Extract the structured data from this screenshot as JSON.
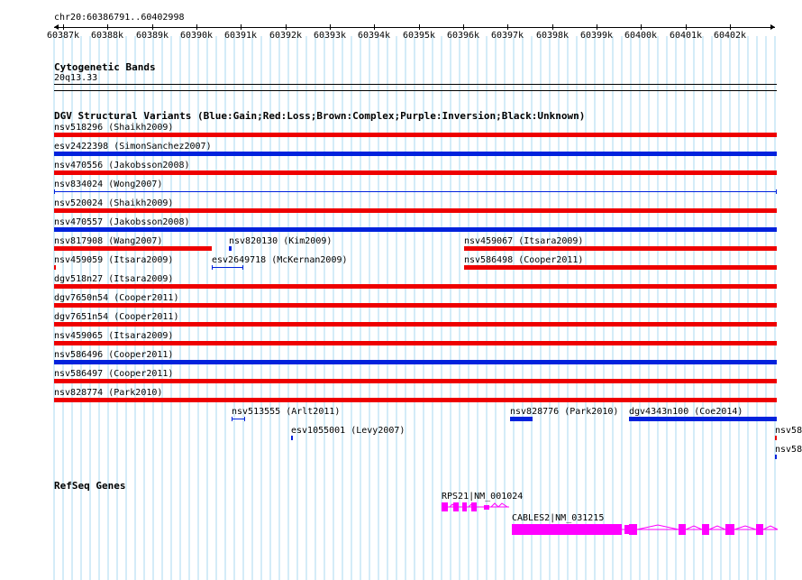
{
  "location": "chr20:60386791..60402998",
  "ruler": {
    "ticks": [
      "60387k",
      "60388k",
      "60389k",
      "60390k",
      "60391k",
      "60392k",
      "60393k",
      "60394k",
      "60395k",
      "60396k",
      "60397k",
      "60398k",
      "60399k",
      "60400k",
      "60401k",
      "60402k"
    ]
  },
  "cytobands": {
    "title": "Cytogenetic Bands",
    "band": "20q13.33"
  },
  "dgv": {
    "title": "DGV Structural Variants (Blue:Gain;Red:Loss;Brown:Complex;Purple:Inversion;Black:Unknown)",
    "features": [
      {
        "label": "nsv518296 (Shaikh2009)",
        "type": "loss"
      },
      {
        "label": "esv2422398 (SimonSanchez2007)",
        "type": "gain"
      },
      {
        "label": "nsv470556 (Jakobsson2008)",
        "type": "loss"
      },
      {
        "label": "nsv834024 (Wong2007)",
        "type": "gain"
      },
      {
        "label": "nsv520024 (Shaikh2009)",
        "type": "loss"
      },
      {
        "label": "nsv470557 (Jakobsson2008)",
        "type": "gain"
      },
      {
        "label": "nsv817908 (Wang2007)",
        "type": "loss"
      },
      {
        "label": "nsv820130 (Kim2009)",
        "type": "gain"
      },
      {
        "label": "nsv459067 (Itsara2009)",
        "type": "loss"
      },
      {
        "label": "nsv459059 (Itsara2009)",
        "type": "loss"
      },
      {
        "label": "esv2649718 (McKernan2009)",
        "type": "gain"
      },
      {
        "label": "nsv586498 (Cooper2011)",
        "type": "loss"
      },
      {
        "label": "dgv518n27 (Itsara2009)",
        "type": "loss"
      },
      {
        "label": "dgv7650n54 (Cooper2011)",
        "type": "loss"
      },
      {
        "label": "dgv7651n54 (Cooper2011)",
        "type": "loss"
      },
      {
        "label": "nsv459065 (Itsara2009)",
        "type": "loss"
      },
      {
        "label": "nsv586496 (Cooper2011)",
        "type": "gain"
      },
      {
        "label": "nsv586497 (Cooper2011)",
        "type": "loss"
      },
      {
        "label": "nsv828774 (Park2010)",
        "type": "loss"
      },
      {
        "label": "nsv513555 (Arlt2011)",
        "type": "gain"
      },
      {
        "label": "nsv828776 (Park2010)",
        "type": "gain"
      },
      {
        "label": "dgv4343n100 (Coe2014)",
        "type": "gain"
      },
      {
        "label": "esv1055001 (Levy2007)",
        "type": "gain"
      },
      {
        "label": "nsv58",
        "type": "loss"
      },
      {
        "label": "nsv58",
        "type": "gain"
      }
    ]
  },
  "refseq": {
    "title": "RefSeq Genes",
    "genes": [
      {
        "label": "RPS21|NM_001024"
      },
      {
        "label": "CABLES2|NM_031215"
      }
    ]
  },
  "colors": {
    "gain": "#0022dd",
    "loss": "#ee0000",
    "gene": "#ff00ff",
    "grid": "#a8d8f0"
  }
}
